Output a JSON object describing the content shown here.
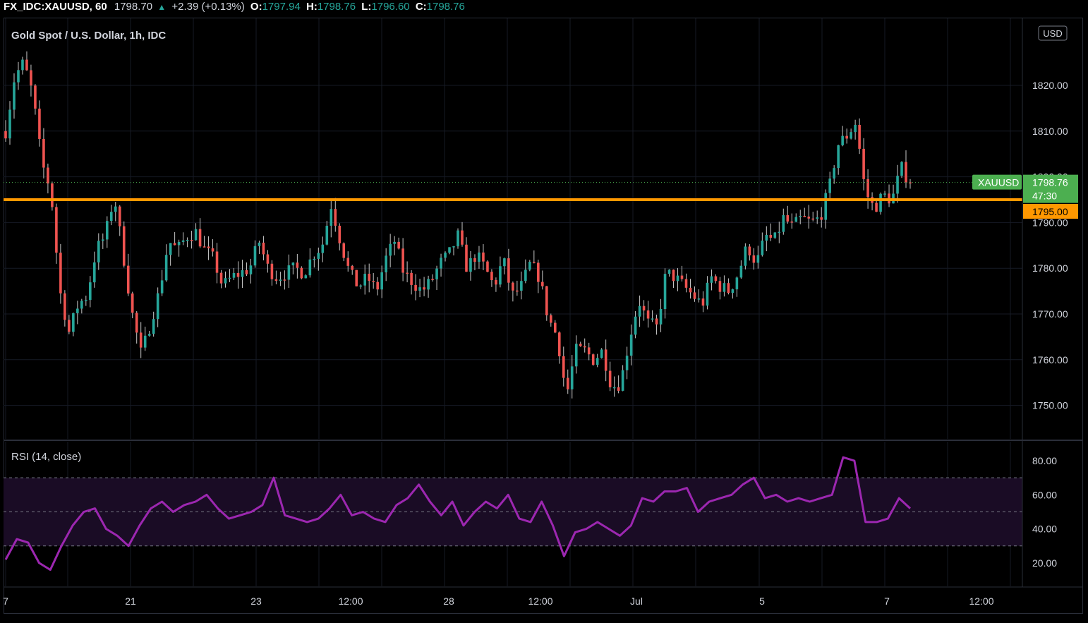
{
  "header": {
    "symbol": "FX_IDC:XAUUSD, 60",
    "last": "1798.70",
    "change": "+2.39 (+0.13%)",
    "open_label": "O:",
    "open": "1797.94",
    "high_label": "H:",
    "high": "1798.76",
    "low_label": "L:",
    "low": "1796.60",
    "close_label": "C:",
    "close": "1798.76"
  },
  "chart_data": [
    {
      "type": "candlestick",
      "title": "Gold Spot / U.S. Dollar, 1h, IDC",
      "currency": "USD",
      "y_ticks": [
        "1820.00",
        "1810.00",
        "1800.00",
        "1790.00",
        "1780.00",
        "1770.00",
        "1760.00",
        "1750.00"
      ],
      "ylim": [
        1745,
        1830
      ],
      "x_ticks": [
        "7",
        "21",
        "23",
        "12:00",
        "28",
        "12:00",
        "Jul",
        "5",
        "7",
        "12:00"
      ],
      "price_trace": [
        1810,
        1822,
        1825,
        1818,
        1803,
        1797,
        1775,
        1766,
        1772,
        1774,
        1784,
        1787,
        1796,
        1783,
        1770,
        1761,
        1768,
        1775,
        1786,
        1784,
        1787,
        1788,
        1784,
        1782,
        1776,
        1778,
        1779,
        1780,
        1786,
        1780,
        1778,
        1779,
        1780,
        1779,
        1783,
        1785,
        1794,
        1786,
        1779,
        1776,
        1778,
        1775,
        1782,
        1786,
        1779,
        1777,
        1775,
        1777,
        1781,
        1783,
        1787,
        1780,
        1783,
        1780,
        1776,
        1782,
        1774,
        1776,
        1781,
        1778,
        1769,
        1765,
        1752,
        1762,
        1762,
        1760,
        1762,
        1754,
        1755,
        1765,
        1773,
        1768,
        1767,
        1779,
        1778,
        1776,
        1774,
        1772,
        1778,
        1776,
        1775,
        1779,
        1785,
        1781,
        1787,
        1786,
        1791,
        1789,
        1791,
        1790,
        1791,
        1797,
        1807,
        1809,
        1812,
        1797,
        1793,
        1796,
        1795,
        1802,
        1798.76
      ],
      "support_level": 1795.0,
      "support_label": "1795.00",
      "last_price": 1798.76,
      "last_price_label": "1798.76",
      "last_symbol": "XAUUSD",
      "countdown": "47:30",
      "colors": {
        "up": "#26a69a",
        "down": "#ef5350",
        "support": "#ff9800",
        "last": "#4caf50"
      }
    },
    {
      "type": "line",
      "title": "RSI (14, close)",
      "y_ticks": [
        "80.00",
        "60.00",
        "40.00",
        "20.00"
      ],
      "ylim": [
        0,
        92
      ],
      "upper_band": 70,
      "middle_band": 50,
      "lower_band": 30,
      "values": [
        22,
        34,
        32,
        20,
        16,
        30,
        42,
        50,
        52,
        40,
        36,
        30,
        42,
        52,
        56,
        50,
        54,
        56,
        60,
        52,
        46,
        48,
        50,
        54,
        70,
        48,
        46,
        44,
        46,
        52,
        60,
        48,
        50,
        46,
        44,
        54,
        58,
        66,
        56,
        48,
        56,
        42,
        50,
        56,
        52,
        60,
        46,
        44,
        56,
        42,
        24,
        38,
        40,
        44,
        40,
        36,
        42,
        58,
        56,
        62,
        62,
        64,
        50,
        56,
        58,
        60,
        66,
        70,
        58,
        60,
        56,
        58,
        56,
        58,
        60,
        82,
        80,
        44,
        44,
        46,
        58,
        52
      ],
      "colors": {
        "line": "#9c27b0",
        "band_fill": "#1a0c25",
        "band_line": "#787b86"
      }
    }
  ]
}
